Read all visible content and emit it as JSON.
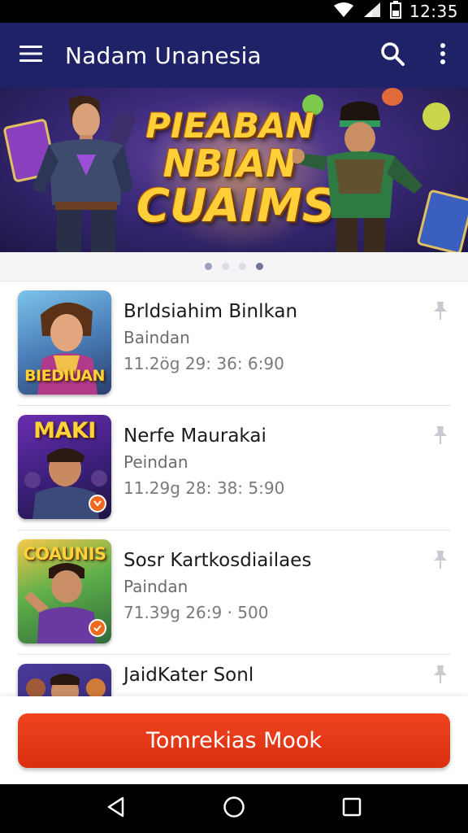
{
  "status_bar": {
    "time": "12:35",
    "icons": [
      "wifi-icon",
      "signal-icon",
      "battery-icon"
    ]
  },
  "app_bar": {
    "title": "Nadam Unanesia",
    "icons": [
      "menu-icon",
      "search-icon",
      "more-vert-icon"
    ],
    "color": "#1f2266"
  },
  "banner": {
    "line1": "PIEABAN",
    "line2": "NBIAN",
    "line3": "CUAIMS",
    "indicator_count": 4,
    "active_indicator": 3
  },
  "games": [
    {
      "title": "Brldsiahim Binlkan",
      "subtitle": "Baindan",
      "meta": "11.2ög 29: 36: 6:90",
      "thumb_label": "BIEDIUAN",
      "thumb_label_position": "bottom"
    },
    {
      "title": "Nerfe Maurakai",
      "subtitle": "Peindan",
      "meta": "11.29g 28: 38: 5:90",
      "thumb_label": "MAKI",
      "thumb_label_position": "top"
    },
    {
      "title": "Sosr Kartkosdiailaes",
      "subtitle": "Paindan",
      "meta": "71.39g 26:9 · 500",
      "thumb_label": "COAUNIS",
      "thumb_label_position": "top"
    },
    {
      "title": "JaidKater Sonl",
      "subtitle": "",
      "meta": "",
      "thumb_label": "",
      "thumb_label_position": "top"
    }
  ],
  "cta": {
    "label": "Tomrekias Mook",
    "color": "#e03515"
  },
  "nav_bar": {
    "icons": [
      "back-icon",
      "home-icon",
      "recents-icon"
    ]
  }
}
